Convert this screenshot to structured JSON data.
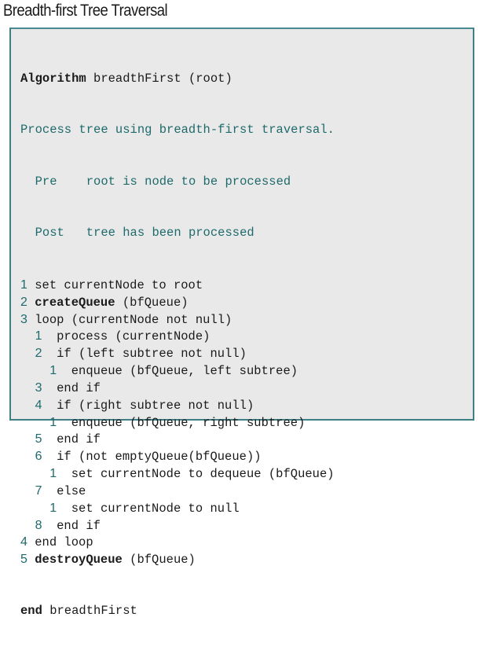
{
  "title": "Breadth-first Tree Traversal",
  "algorithm": {
    "header_keyword": "Algorithm",
    "header_rest": " breadthFirst (root)",
    "description": "Process tree using breadth-first traversal.",
    "pre_label": "Pre",
    "pre_text": "root is node to be processed",
    "post_label": "Post",
    "post_text": "tree has been processed",
    "lines": [
      {
        "indent": 0,
        "num": "1",
        "text": "set currentNode to root"
      },
      {
        "indent": 0,
        "num": "2",
        "bold": "createQueue",
        "text": " (bfQueue)"
      },
      {
        "indent": 0,
        "num": "3",
        "text": "loop (currentNode not null)"
      },
      {
        "indent": 1,
        "num": "1",
        "text": "process (currentNode)"
      },
      {
        "indent": 1,
        "num": "2",
        "text": "if (left subtree not null)"
      },
      {
        "indent": 2,
        "num": "1",
        "text": "enqueue (bfQueue, left subtree)"
      },
      {
        "indent": 1,
        "num": "3",
        "text": "end if"
      },
      {
        "indent": 1,
        "num": "4",
        "text": "if (right subtree not null)"
      },
      {
        "indent": 2,
        "num": "1",
        "text": "enqueue (bfQueue, right subtree)"
      },
      {
        "indent": 1,
        "num": "5",
        "text": "end if"
      },
      {
        "indent": 1,
        "num": "6",
        "text": "if (not emptyQueue(bfQueue))"
      },
      {
        "indent": 2,
        "num": "1",
        "text": "set currentNode to dequeue (bfQueue)"
      },
      {
        "indent": 1,
        "num": "7",
        "text": "else"
      },
      {
        "indent": 2,
        "num": "1",
        "text": "set currentNode to null"
      },
      {
        "indent": 1,
        "num": "8",
        "text": "end if"
      },
      {
        "indent": 0,
        "num": "4",
        "text": "end loop"
      },
      {
        "indent": 0,
        "num": "5",
        "bold": "destroyQueue",
        "text": " (bfQueue)"
      }
    ],
    "footer_keyword": "end",
    "footer_rest": " breadthFirst"
  },
  "colors": {
    "border": "#3f7f86",
    "background": "#e9e9e9",
    "comment_text": "#1f6a6c",
    "code_text": "#1a1a1a"
  }
}
